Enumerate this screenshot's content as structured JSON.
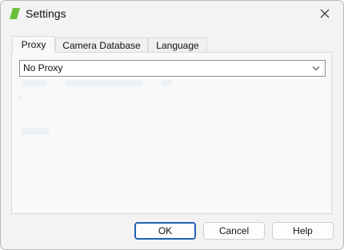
{
  "window": {
    "title": "Settings",
    "icon": "green-leaf-app-icon",
    "close_icon": "close-icon"
  },
  "tabs": [
    {
      "label": "Proxy",
      "active": true
    },
    {
      "label": "Camera Database",
      "active": false
    },
    {
      "label": "Language",
      "active": false
    }
  ],
  "proxy": {
    "mode_selected": "No Proxy",
    "chevron_icon": "chevron-down-icon"
  },
  "buttons": {
    "ok": "OK",
    "cancel": "Cancel",
    "help": "Help"
  },
  "colors": {
    "accent": "#1f62b3",
    "app_icon_green": "#6abf3a"
  }
}
